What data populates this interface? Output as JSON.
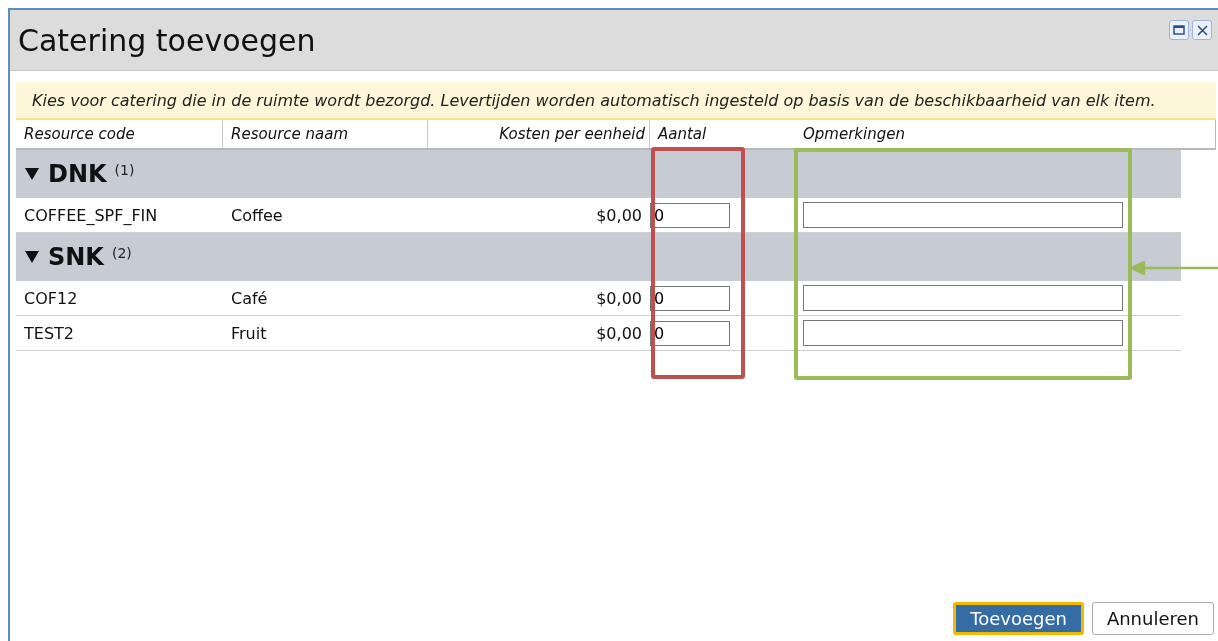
{
  "window": {
    "title": "Catering toevoegen"
  },
  "notice": "Kies voor catering die in de ruimte wordt bezorgd. Levertijden worden automatisch ingesteld op basis van de beschikbaarheid van elk item.",
  "table": {
    "columns": [
      "Resource code",
      "Resource naam",
      "Kosten per eenheid",
      "Aantal",
      "Opmerkingen"
    ],
    "groups": [
      {
        "name": "DNK",
        "count": "(1)",
        "expanded": true,
        "rows": [
          {
            "code": "COFFEE_SPF_FIN",
            "name": "Coffee",
            "cost": "$0,00",
            "quantity": "0"
          }
        ]
      },
      {
        "name": "SNK",
        "count": "(2)",
        "expanded": true,
        "rows": [
          {
            "code": "COF12",
            "name": "Café",
            "cost": "$0,00",
            "quantity": "0"
          },
          {
            "code": "TEST2",
            "name": "Fruit",
            "cost": "$0,00",
            "quantity": "0"
          }
        ]
      }
    ]
  },
  "buttons": [
    {
      "label": "Toevoegen",
      "kind": "primary"
    },
    {
      "label": "Annuleren",
      "kind": "secondary"
    }
  ]
}
